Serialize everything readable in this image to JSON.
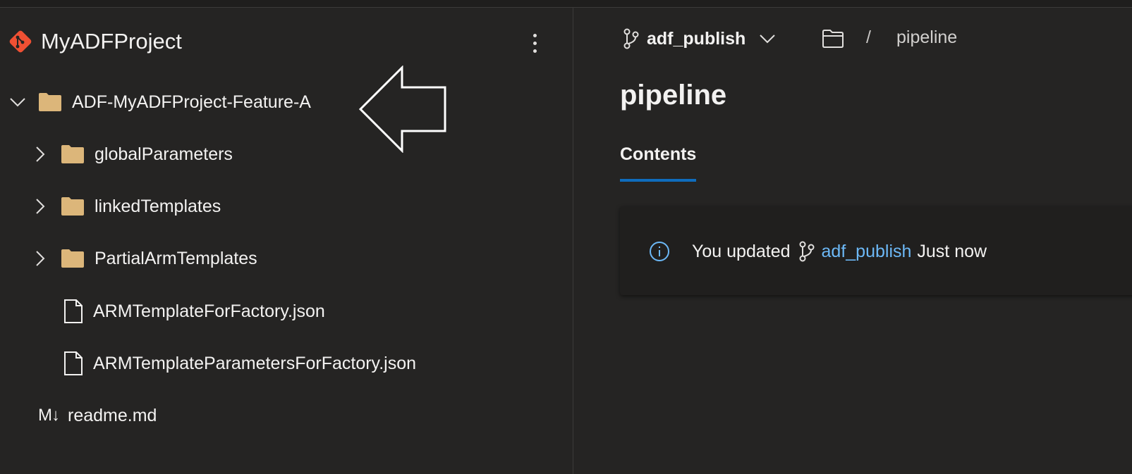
{
  "project": {
    "title": "MyADFProject"
  },
  "tree": {
    "root_folder": "ADF-MyADFProject-Feature-A",
    "children": [
      {
        "label": "globalParameters",
        "type": "folder"
      },
      {
        "label": "linkedTemplates",
        "type": "folder"
      },
      {
        "label": "PartialArmTemplates",
        "type": "folder"
      },
      {
        "label": "ARMTemplateForFactory.json",
        "type": "file"
      },
      {
        "label": "ARMTemplateParametersForFactory.json",
        "type": "file"
      }
    ],
    "readme_icon": "M↓",
    "readme": "readme.md"
  },
  "header": {
    "branch": "adf_publish",
    "breadcrumb_separator": "/",
    "breadcrumb_item": "pipeline"
  },
  "main": {
    "title": "pipeline",
    "tab": "Contents",
    "notice": {
      "prefix": "You updated",
      "branch": "adf_publish",
      "suffix": "Just now"
    }
  },
  "colors": {
    "accent": "#0f6cbd",
    "link": "#6cb8f6",
    "folder": "#dcb67a",
    "git_logo": "#f05033"
  }
}
